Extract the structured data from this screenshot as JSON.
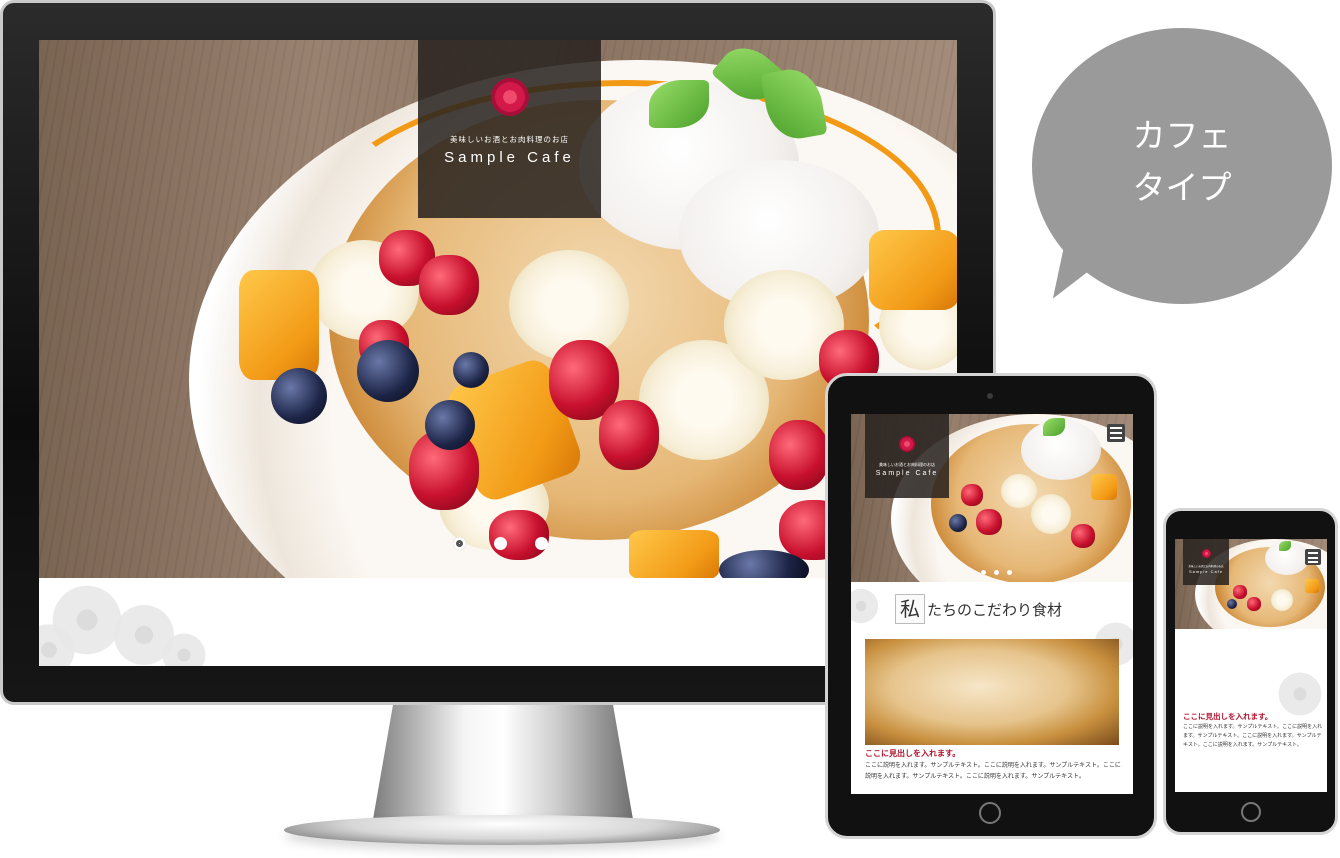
{
  "bubble": {
    "line1": "カフェ",
    "line2": "タイプ"
  },
  "site": {
    "tagline": "美味しいお酒とお肉料理のお店",
    "name": "Sample Cafe",
    "slider_dots": 3,
    "active_dot": 1
  },
  "tablet": {
    "section_first_char": "私",
    "section_rest": "たちのこだわり食材",
    "heading": "ここに見出しを入れます。",
    "body": "ここに説明を入れます。サンプルテキスト。ここに説明を入れます。サンプルテキスト。ここに説明を入れます。サンプルテキスト。ここに説明を入れます。サンプルテキスト。"
  },
  "phone": {
    "heading": "ここに見出しを入れます。",
    "body": "ここに説明を入れます。サンプルテキスト。ここに説明を入れます。サンプルテキスト。ここに説明を入れます。サンプルテキスト。ここに説明を入れます。サンプルテキスト。"
  },
  "icons": [
    "flower-logo-icon",
    "hamburger-menu-icon",
    "home-button-icon"
  ]
}
